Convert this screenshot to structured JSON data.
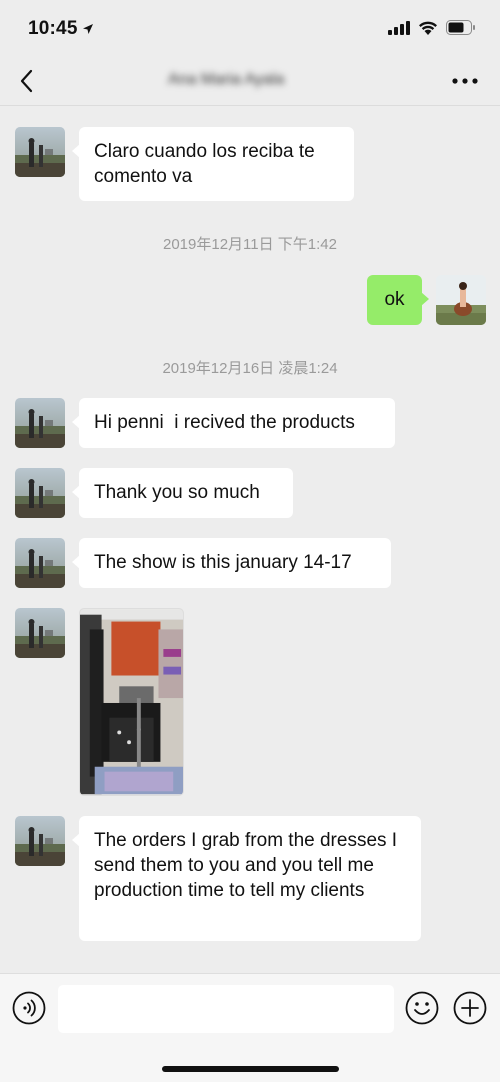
{
  "status_bar": {
    "time": "10:45",
    "icons": [
      "location-arrow-icon",
      "signal-icon",
      "wifi-icon",
      "battery-icon"
    ]
  },
  "nav": {
    "title": "Ana Maria Ayala",
    "back_icon": "chevron-left-icon",
    "more_icon": "more-dots-icon"
  },
  "messages": {
    "m1": "Claro cuando los reciba te comento va",
    "ts1": "2019年12月11日 下午1:42",
    "m2": "ok",
    "ts2": "2019年12月16日 凌晨1:24",
    "m3": "Hi penni  i recived the products",
    "m4": "Thank you so much",
    "m5": "The show is this january 14-17",
    "m6": "The orders I grab from the dresses I send them to you and you tell me production time to tell my clients"
  },
  "input_bar": {
    "placeholder": "",
    "icons": [
      "voice-icon",
      "emoji-icon",
      "plus-icon"
    ]
  },
  "colors": {
    "background": "#ededed",
    "bubble_other": "#ffffff",
    "bubble_mine": "#95ec69",
    "timestamp": "#9a9a9a"
  }
}
